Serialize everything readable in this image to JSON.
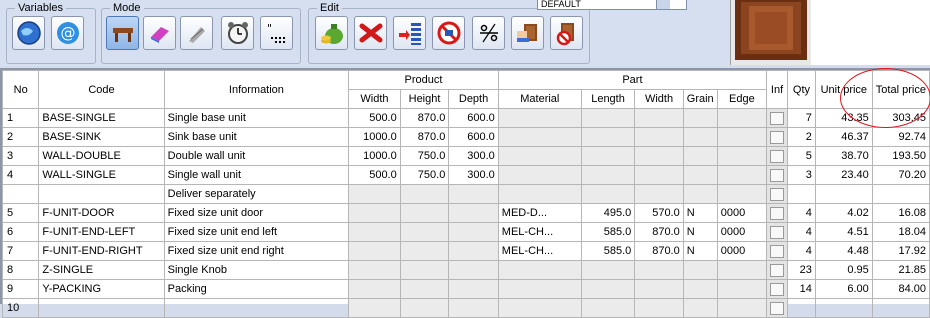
{
  "toolbar": {
    "variables_label": "Variables",
    "mode_label": "Mode",
    "edit_label": "Edit",
    "combo_value": "DEFAULT"
  },
  "table": {
    "headers": {
      "no": "No",
      "code": "Code",
      "information": "Information",
      "product": "Product",
      "part": "Part",
      "width": "Width",
      "height": "Height",
      "depth": "Depth",
      "material": "Material",
      "length": "Length",
      "part_width": "Width",
      "grain": "Grain",
      "edge": "Edge",
      "inf": "Inf",
      "qty": "Qty",
      "unit_price": "Unit price",
      "total_price": "Total price"
    },
    "rows": [
      {
        "no": "1",
        "code": "BASE-SINGLE",
        "info": "Single base unit",
        "width": "500.0",
        "height": "870.0",
        "depth": "600.0",
        "material": "",
        "length": "",
        "pwidth": "",
        "grain": "",
        "edge": "",
        "qty": "7",
        "unit": "43.35",
        "total": "303.45"
      },
      {
        "no": "2",
        "code": "BASE-SINK",
        "info": "Sink base unit",
        "width": "1000.0",
        "height": "870.0",
        "depth": "600.0",
        "material": "",
        "length": "",
        "pwidth": "",
        "grain": "",
        "edge": "",
        "qty": "2",
        "unit": "46.37",
        "total": "92.74"
      },
      {
        "no": "3",
        "code": "WALL-DOUBLE",
        "info": "Double wall unit",
        "width": "1000.0",
        "height": "750.0",
        "depth": "300.0",
        "material": "",
        "length": "",
        "pwidth": "",
        "grain": "",
        "edge": "",
        "qty": "5",
        "unit": "38.70",
        "total": "193.50"
      },
      {
        "no": "4",
        "code": "WALL-SINGLE",
        "info": "Single wall unit",
        "width": "500.0",
        "height": "750.0",
        "depth": "300.0",
        "material": "",
        "length": "",
        "pwidth": "",
        "grain": "",
        "edge": "",
        "qty": "3",
        "unit": "23.40",
        "total": "70.20"
      },
      {
        "no": "",
        "code": "",
        "info": "Deliver separately",
        "width": "",
        "height": "",
        "depth": "",
        "material": "",
        "length": "",
        "pwidth": "",
        "grain": "",
        "edge": "",
        "qty": "",
        "unit": "",
        "total": ""
      },
      {
        "no": "5",
        "code": "F-UNIT-DOOR",
        "info": "Fixed size unit door",
        "width": "",
        "height": "",
        "depth": "",
        "material": "MED-D...",
        "length": "495.0",
        "pwidth": "570.0",
        "grain": "N",
        "edge": "0000",
        "qty": "4",
        "unit": "4.02",
        "total": "16.08"
      },
      {
        "no": "6",
        "code": "F-UNIT-END-LEFT",
        "info": "Fixed size unit end left",
        "width": "",
        "height": "",
        "depth": "",
        "material": "MEL-CH...",
        "length": "585.0",
        "pwidth": "870.0",
        "grain": "N",
        "edge": "0000",
        "qty": "4",
        "unit": "4.51",
        "total": "18.04"
      },
      {
        "no": "7",
        "code": "F-UNIT-END-RIGHT",
        "info": "Fixed size unit end right",
        "width": "",
        "height": "",
        "depth": "",
        "material": "MEL-CH...",
        "length": "585.0",
        "pwidth": "870.0",
        "grain": "N",
        "edge": "0000",
        "qty": "4",
        "unit": "4.48",
        "total": "17.92"
      },
      {
        "no": "8",
        "code": "Z-SINGLE",
        "info": "Single Knob",
        "width": "",
        "height": "",
        "depth": "",
        "material": "",
        "length": "",
        "pwidth": "",
        "grain": "",
        "edge": "",
        "qty": "23",
        "unit": "0.95",
        "total": "21.85"
      },
      {
        "no": "9",
        "code": "Y-PACKING",
        "info": "Packing",
        "width": "",
        "height": "",
        "depth": "",
        "material": "",
        "length": "",
        "pwidth": "",
        "grain": "",
        "edge": "",
        "qty": "14",
        "unit": "6.00",
        "total": "84.00"
      },
      {
        "no": "10",
        "code": "",
        "info": "",
        "width": "",
        "height": "",
        "depth": "",
        "material": "",
        "length": "",
        "pwidth": "",
        "grain": "",
        "edge": "",
        "qty": "",
        "unit": "",
        "total": ""
      }
    ]
  },
  "colors": {
    "highlight_circle": "#e0141e",
    "active_button": "#8fb6e6"
  },
  "icons": [
    "globe-icon",
    "at-icon",
    "table-icon",
    "eraser-icon",
    "screw-icon",
    "alarm-clock-icon",
    "quote-dots-icon",
    "money-bag-icon",
    "red-x-icon",
    "insert-rows-icon",
    "no-entry-icon",
    "divide-icon",
    "cabinet-hand-icon",
    "cabinet-no-icon"
  ]
}
